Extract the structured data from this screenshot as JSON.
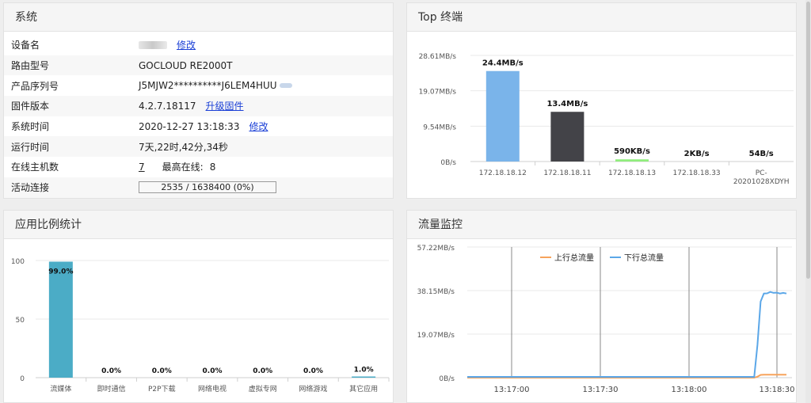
{
  "system": {
    "title": "系统",
    "rows": [
      {
        "label": "设备名",
        "value": "",
        "action": "修改"
      },
      {
        "label": "路由型号",
        "value": "GOCLOUD RE2000T"
      },
      {
        "label": "产品序列号",
        "value": "J5MJW2**********J6LEM4HUU"
      },
      {
        "label": "固件版本",
        "value": "4.2.7.18117",
        "action": "升级固件"
      },
      {
        "label": "系统时间",
        "value": "2020-12-27 13:18:33",
        "action": "修改"
      },
      {
        "label": "运行时间",
        "value": "7天,22时,42分,34秒"
      },
      {
        "label": "在线主机数",
        "value": "7",
        "extra_label": "最高在线:",
        "extra_value": "8"
      },
      {
        "label": "活动连接",
        "value": "2535 / 1638400 (0%)"
      }
    ]
  },
  "top_terminals": {
    "title": "Top 终端",
    "chart_data": {
      "type": "bar",
      "categories": [
        "172.18.18.12",
        "172.18.18.11",
        "172.18.18.13",
        "172.18.18.33",
        "PC-20201028XDYH"
      ],
      "values_mbps": [
        24.4,
        13.4,
        0.59,
        0.002,
        5.4e-05
      ],
      "data_labels": [
        "24.4MB/s",
        "13.4MB/s",
        "590KB/s",
        "2KB/s",
        "54B/s"
      ],
      "bar_colors": [
        "#7ab4ea",
        "#434348",
        "#90ed7d",
        "#f7a35c",
        "#8085e9"
      ],
      "yticks": [
        "28.61MB/s",
        "19.07MB/s",
        "9.54MB/s",
        "0B/s"
      ],
      "ylim": [
        0,
        28.61
      ]
    }
  },
  "app_stats": {
    "title": "应用比例统计",
    "chart_data": {
      "type": "bar",
      "categories": [
        "流媒体",
        "即时通信",
        "P2P下载",
        "网络电视",
        "虚拟专网",
        "网络游戏",
        "其它应用"
      ],
      "values": [
        99.0,
        0.0,
        0.0,
        0.0,
        0.0,
        0.0,
        1.0
      ],
      "data_labels": [
        "99.0%",
        "0.0%",
        "0.0%",
        "0.0%",
        "0.0%",
        "0.0%",
        "1.0%"
      ],
      "yticks": [
        "100",
        "50",
        "0"
      ],
      "ylim": [
        0,
        100
      ],
      "bar_color": "#4bacc6"
    }
  },
  "traffic": {
    "title": "流量监控",
    "chart_data": {
      "type": "line",
      "yticks": [
        "57.22MB/s",
        "38.15MB/s",
        "19.07MB/s",
        "0B/s"
      ],
      "ylim": [
        0,
        57.22
      ],
      "xticks": [
        "13:17:00",
        "13:17:30",
        "13:18:00",
        "13:18:30"
      ],
      "legend": [
        "上行总流量",
        "下行总流量"
      ],
      "legend_colors": [
        "#f7a35c",
        "#5ba7e8"
      ],
      "series": [
        {
          "name": "上行总流量",
          "values": [
            0,
            0,
            0,
            0,
            0,
            0,
            0,
            0,
            0,
            0,
            0,
            0,
            0,
            0,
            0,
            0,
            0,
            0,
            0,
            0,
            0,
            0,
            0,
            0,
            0,
            0,
            0,
            0,
            0,
            0,
            0,
            0,
            0,
            0,
            0,
            0,
            0,
            0,
            0,
            0,
            0,
            0,
            0,
            0,
            0,
            0,
            0,
            0,
            0,
            0,
            0,
            0,
            0,
            0,
            0,
            0,
            0,
            0,
            0,
            0,
            0,
            0,
            0,
            0,
            0,
            0,
            0,
            0,
            0,
            0,
            0,
            0,
            0,
            0,
            0,
            0,
            0,
            0,
            0,
            0,
            0,
            0,
            0,
            0,
            0,
            0,
            0,
            0,
            0,
            0,
            0.4,
            1.2,
            1.3,
            1.3,
            1.3,
            1.3,
            1.3,
            1.3,
            1.3,
            1.3
          ]
        },
        {
          "name": "下行总流量",
          "values": [
            0,
            0,
            0,
            0,
            0,
            0,
            0,
            0,
            0,
            0,
            0,
            0,
            0,
            0,
            0,
            0,
            0,
            0,
            0,
            0,
            0,
            0,
            0,
            0,
            0,
            0,
            0,
            0,
            0,
            0,
            0,
            0,
            0,
            0,
            0,
            0,
            0,
            0,
            0,
            0,
            0,
            0,
            0,
            0,
            0,
            0,
            0,
            0,
            0,
            0,
            0,
            0,
            0,
            0,
            0,
            0,
            0,
            0,
            0,
            0,
            0,
            0,
            0,
            0,
            0,
            0,
            0,
            0,
            0,
            0,
            0,
            0,
            0,
            0,
            0,
            0,
            0,
            0,
            0,
            0,
            0,
            0,
            0,
            0,
            0,
            0,
            0,
            0,
            0,
            0,
            14,
            33,
            36.5,
            36.6,
            37.2,
            36.8,
            36.9,
            36.5,
            36.8,
            36.5
          ]
        }
      ],
      "x_span_points": 100
    }
  }
}
